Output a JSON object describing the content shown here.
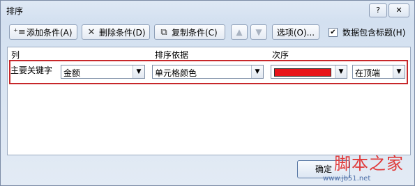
{
  "window": {
    "title": "排序",
    "help_label": "?",
    "close_label": "✕"
  },
  "toolbar": {
    "add_label": "添加条件(A)",
    "delete_label": "删除条件(D)",
    "copy_label": "复制条件(C)",
    "options_label": "选项(O)...",
    "header_checkbox_label": "数据包含标题(H)",
    "header_checked": true
  },
  "columns": {
    "col": "列",
    "basis": "排序依据",
    "order": "次序"
  },
  "rule": {
    "label": "主要关键字",
    "key": "金额",
    "basis": "单元格颜色",
    "color": "#e8141a",
    "position": "在顶端"
  },
  "footer": {
    "ok_label": "确定"
  },
  "watermark": {
    "text": "脚本之家",
    "sub": "www.jb51.net"
  },
  "icons": {
    "add": "add-condition-icon",
    "delete": "delete-condition-icon",
    "copy": "copy-condition-icon",
    "up": "move-up-icon",
    "down": "move-down-icon",
    "dropdown": "chevron-down-icon"
  }
}
